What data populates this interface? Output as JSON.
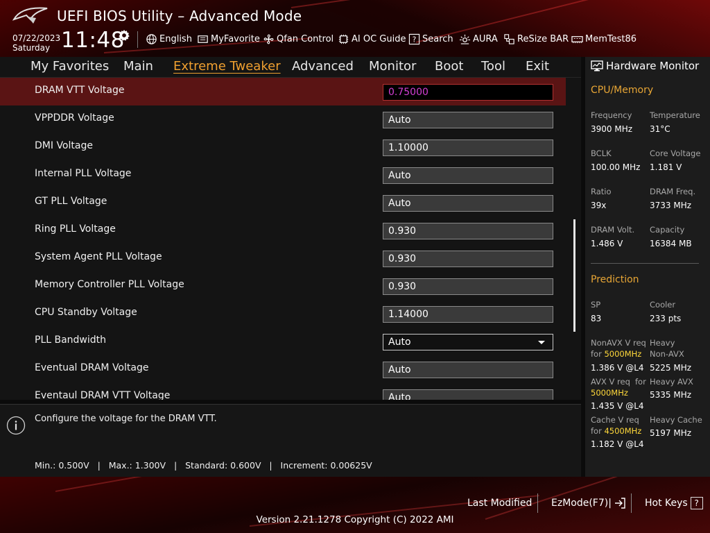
{
  "header": {
    "title": "UEFI BIOS Utility – Advanced Mode",
    "date": "07/22/2023",
    "day": "Saturday",
    "time": "11:48",
    "tools": [
      {
        "label": "English",
        "icon": "globe-icon"
      },
      {
        "label": "MyFavorite",
        "icon": "favorite-icon"
      },
      {
        "label": "Qfan Control",
        "icon": "fan-icon"
      },
      {
        "label": "AI OC Guide",
        "icon": "chip-icon"
      },
      {
        "label": "Search",
        "icon": "search-icon"
      },
      {
        "label": "AURA",
        "icon": "aura-icon"
      },
      {
        "label": "ReSize BAR",
        "icon": "resize-bar-icon"
      },
      {
        "label": "MemTest86",
        "icon": "memory-icon"
      }
    ]
  },
  "menu": {
    "items": [
      "My Favorites",
      "Main",
      "Extreme Tweaker",
      "Advanced",
      "Monitor",
      "Boot",
      "Tool",
      "Exit"
    ],
    "active": "Extreme Tweaker"
  },
  "settings": {
    "rows": [
      {
        "label": "DRAM VTT Voltage",
        "value": "0.75000"
      },
      {
        "label": "VPPDDR Voltage",
        "value": "Auto"
      },
      {
        "label": "DMI Voltage",
        "value": "1.10000"
      },
      {
        "label": "Internal PLL Voltage",
        "value": "Auto"
      },
      {
        "label": "GT PLL Voltage",
        "value": "Auto"
      },
      {
        "label": "Ring PLL Voltage",
        "value": "0.930"
      },
      {
        "label": "System Agent PLL Voltage",
        "value": "0.930"
      },
      {
        "label": "Memory Controller PLL Voltage",
        "value": "0.930"
      },
      {
        "label": "CPU Standby Voltage",
        "value": "1.14000"
      },
      {
        "label": "PLL Bandwidth",
        "value": "Auto"
      },
      {
        "label": "Eventual DRAM Voltage",
        "value": "Auto"
      },
      {
        "label": "Eventaul DRAM VTT Voltage",
        "value": "Auto"
      }
    ]
  },
  "help": {
    "text": "Configure the voltage for the DRAM VTT.",
    "range": "Min.: 0.500V   |   Max.: 1.300V   |   Standard: 0.600V   |   Increment: 0.00625V"
  },
  "hardware_monitor": {
    "title": "Hardware Monitor",
    "cpu_memory_title": "CPU/Memory",
    "frequency_label": "Frequency",
    "frequency_value": "3900 MHz",
    "temperature_label": "Temperature",
    "temperature_value": "31°C",
    "bclk_label": "BCLK",
    "bclk_value": "100.00 MHz",
    "core_voltage_label": "Core Voltage",
    "core_voltage_value": "1.181 V",
    "ratio_label": "Ratio",
    "ratio_value": "39x",
    "dram_freq_label": "DRAM Freq.",
    "dram_freq_value": "3733 MHz",
    "dram_volt_label": "DRAM Volt.",
    "dram_volt_value": "1.486 V",
    "capacity_label": "Capacity",
    "capacity_value": "16384 MB",
    "prediction_title": "Prediction",
    "sp_label": "SP",
    "sp_value": "83",
    "cooler_label": "Cooler",
    "cooler_value": "233 pts",
    "nonavx_req_label_1": "NonAVX V req",
    "nonavx_req_label_2": "for",
    "nonavx_freq": "5000MHz",
    "nonavx_value": "1.386 V @L4",
    "heavy_nonavx_label_1": "Heavy",
    "heavy_nonavx_label_2": "Non-AVX",
    "heavy_nonavx_value": "5225 MHz",
    "avx_req_label": "AVX V req",
    "avx_for": "for",
    "avx_freq": "5000MHz",
    "avx_value": "1.435 V @L4",
    "heavy_avx_label": "Heavy AVX",
    "heavy_avx_value": "5335 MHz",
    "cache_req_label_1": "Cache V req",
    "cache_req_label_2": "for",
    "cache_freq": "4500MHz",
    "cache_value": "1.182 V @L4",
    "heavy_cache_label": "Heavy Cache",
    "heavy_cache_value": "5197 MHz"
  },
  "footer": {
    "last_modified": "Last Modified",
    "ezmode": "EzMode(F7)|",
    "hot_keys": "Hot Keys",
    "hot_keys_icon": "?",
    "version": "Version 2.21.1278 Copyright (C) 2022 AMI"
  },
  "colors": {
    "accent_orange": "#f0a030",
    "highlight_yellow": "#ffd83a",
    "selected_row": "#5a1414",
    "selected_value": "#d43fd4"
  }
}
